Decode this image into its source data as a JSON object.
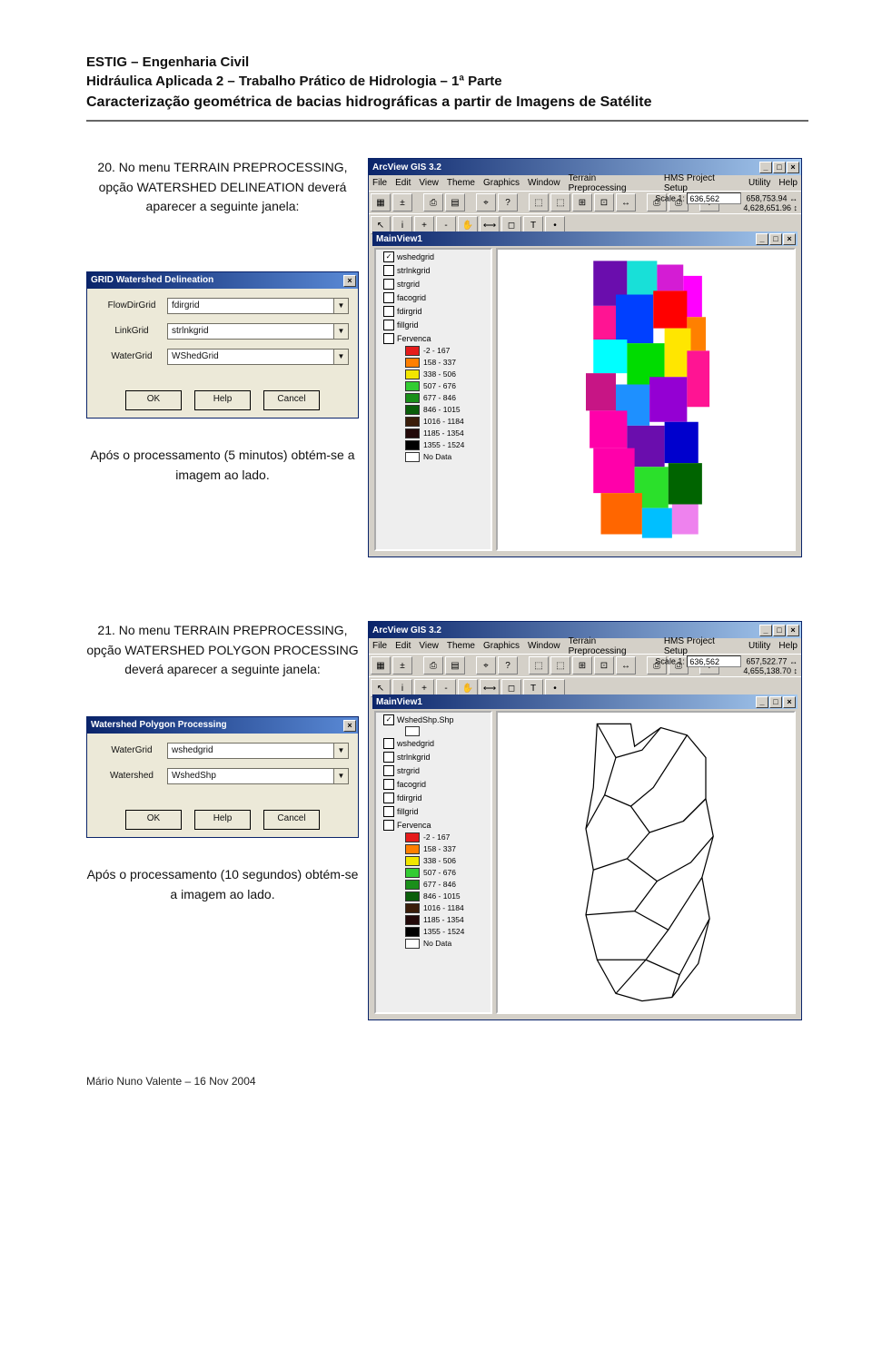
{
  "header": {
    "line1": "ESTIG – Engenharia Civil",
    "line2": "Hidráulica Aplicada 2 – Trabalho Prático de Hidrologia – 1ª Parte",
    "line3": "Caracterização geométrica de bacias hidrográficas a partir de Imagens de Satélite"
  },
  "step20": {
    "text": "20. No menu TERRAIN PREPROCESSING, opção WATERSHED DELINEATION deverá aparecer a seguinte janela:",
    "after": "Após o processamento (5 minutos) obtém-se a imagem ao lado."
  },
  "dlg20": {
    "title": "GRID Watershed Delineation",
    "rows": [
      {
        "label": "FlowDirGrid",
        "value": "fdirgrid"
      },
      {
        "label": "LinkGrid",
        "value": "strlnkgrid"
      },
      {
        "label": "WaterGrid",
        "value": "WShedGrid"
      }
    ],
    "buttons": [
      "OK",
      "Help",
      "Cancel"
    ]
  },
  "step21": {
    "text": "21. No menu TERRAIN PREPROCESSING, opção WATERSHED POLYGON PROCESSING deverá aparecer a seguinte janela:",
    "after": "Após o processamento (10 segundos) obtém-se a imagem ao lado."
  },
  "dlg21": {
    "title": "Watershed Polygon Processing",
    "rows": [
      {
        "label": "WaterGrid",
        "value": "wshedgrid"
      },
      {
        "label": "Watershed",
        "value": "WshedShp"
      }
    ],
    "buttons": [
      "OK",
      "Help",
      "Cancel"
    ]
  },
  "arcview": {
    "title": "ArcView GIS 3.2",
    "menus": [
      "File",
      "Edit",
      "View",
      "Theme",
      "Graphics",
      "Window",
      "Terrain Preprocessing",
      "HMS Project Setup",
      "Utility",
      "Help"
    ],
    "scale_label": "Scale 1:",
    "scale_value": "636,562",
    "coords20_a": "658,753.94",
    "coords20_b": "4,628,651.96",
    "coords21_a": "657,522.77",
    "coords21_b": "4,655,138.70",
    "mainview": "MainView1",
    "toc20": {
      "checked": "wshedgrid",
      "others": [
        "strlnkgrid",
        "strgrid",
        "facogrid",
        "fdirgrid",
        "fillgrid",
        "Fervenca"
      ],
      "legend_group": "Fervenca",
      "legend": [
        {
          "label": "-2 - 167",
          "color": "#e51b1b"
        },
        {
          "label": "158 - 337",
          "color": "#ff7f00"
        },
        {
          "label": "338 - 506",
          "color": "#f2e600"
        },
        {
          "label": "507 - 676",
          "color": "#33cc33"
        },
        {
          "label": "677 - 846",
          "color": "#1a8f1a"
        },
        {
          "label": "846 - 1015",
          "color": "#0a5d0a"
        },
        {
          "label": "1016 - 1184",
          "color": "#3a1d0a"
        },
        {
          "label": "1185 - 1354",
          "color": "#220909"
        },
        {
          "label": "1355 - 1524",
          "color": "#000000"
        },
        {
          "label": "No Data",
          "color": "#ffffff"
        }
      ]
    },
    "toc21": {
      "checked": "WshedShp.Shp",
      "unchecked_extra": "wshedgrid",
      "others": [
        "strlnkgrid",
        "strgrid",
        "facogrid",
        "fdirgrid",
        "fillgrid",
        "Fervenca"
      ]
    }
  },
  "footer": "Mário Nuno Valente – 16 Nov 2004"
}
